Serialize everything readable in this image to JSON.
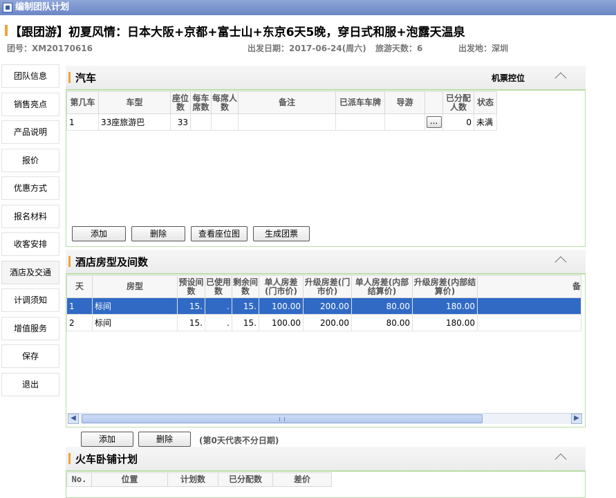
{
  "window": {
    "title": "编制团队计划"
  },
  "header": {
    "title": "【跟团游】初夏风情：日本大阪+京都+富士山+东京6天5晚，穿日式和服+泡露天温泉",
    "group_no": "团号：XM20170616",
    "depart_date": "出发日期：2017-06-24(周六)",
    "days": "旅游天数：6",
    "depart_from": "出发地：深圳"
  },
  "sidebar": {
    "items": [
      {
        "label": "团队信息"
      },
      {
        "label": "销售亮点"
      },
      {
        "label": "产品说明"
      },
      {
        "label": "报价"
      },
      {
        "label": "优惠方式"
      },
      {
        "label": "报名材料"
      },
      {
        "label": "收客安排"
      },
      {
        "label": "酒店及交通"
      },
      {
        "label": "计调须知"
      },
      {
        "label": "增值服务"
      },
      {
        "label": "保存"
      },
      {
        "label": "退出"
      }
    ]
  },
  "bus": {
    "title": "汽车",
    "extra": "机票控位",
    "columns": [
      "第几车",
      "车型",
      "座位数",
      "每车席数",
      "每席人数",
      "备注",
      "已派车车牌",
      "导游",
      "",
      "已分配人数",
      "状态"
    ],
    "rows": [
      {
        "no": "1",
        "type": "33座旅游巴",
        "seats": "33",
        "per_car": "",
        "per_seat": "",
        "remark": "",
        "plate": "",
        "guide": "",
        "btn": "...",
        "assigned": "0",
        "status": "未满"
      }
    ],
    "buttons": {
      "add": "添加",
      "delete": "删除",
      "seatmap": "查看座位图",
      "ticket": "生成团票"
    }
  },
  "hotel": {
    "title": "酒店房型及间数",
    "columns": [
      "天",
      "房型",
      "预设间数",
      "已使用数",
      "剩余间数",
      "单人房差(门市价)",
      "升级房差(门市价)",
      "单人房差(内部结算价)",
      "升级房差(内部结算价)",
      "备"
    ],
    "rows": [
      {
        "day": "1",
        "room": "标间",
        "preset": "15.",
        "used": ".",
        "left": "15.",
        "single": "100.00",
        "upgrade": "200.00",
        "single_in": "80.00",
        "upgrade_in": "180.00"
      },
      {
        "day": "2",
        "room": "标间",
        "preset": "15.",
        "used": ".",
        "left": "15.",
        "single": "100.00",
        "upgrade": "200.00",
        "single_in": "80.00",
        "upgrade_in": "180.00"
      }
    ],
    "buttons": {
      "add": "添加",
      "delete": "删除"
    },
    "note": "(第0天代表不分日期)"
  },
  "train": {
    "title": "火车卧铺计划",
    "columns": [
      "No.",
      "位置",
      "计划数",
      "已分配数",
      "差价"
    ]
  }
}
